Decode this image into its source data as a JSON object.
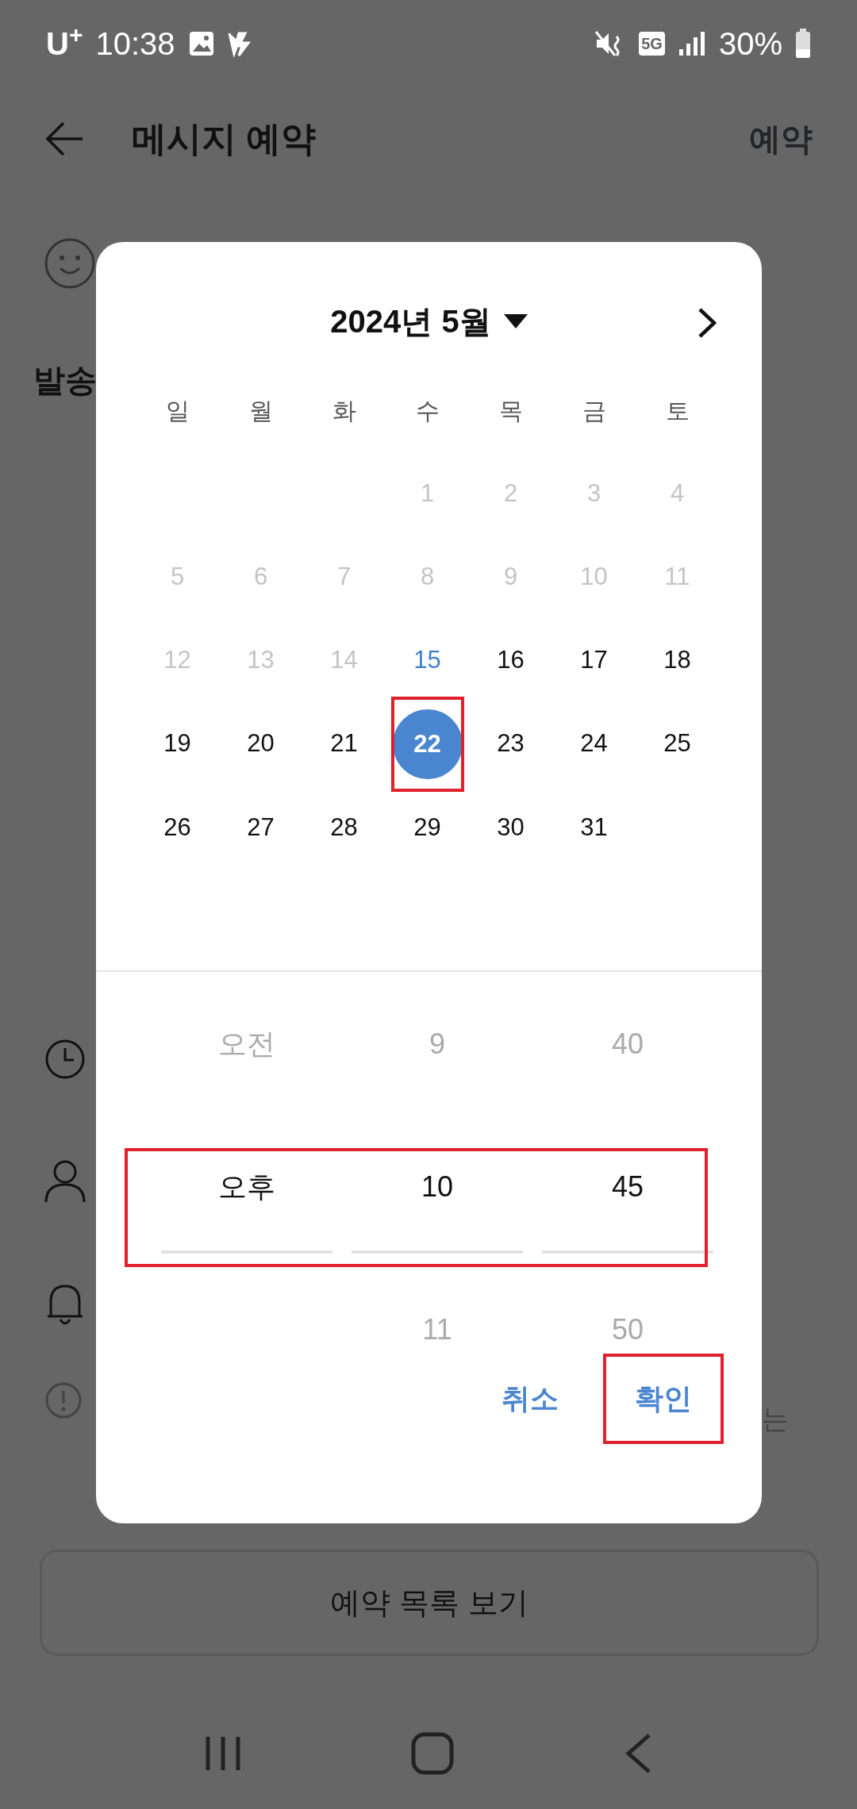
{
  "status_bar": {
    "carrier": "U$^{+}$",
    "time": "10:38",
    "network": "5G",
    "battery": "30%"
  },
  "app_bar": {
    "title": "메시지 예약",
    "action": "예약"
  },
  "background": {
    "section_label": "발송",
    "hint_fragment": "는",
    "list_button": "예약 목록 보기"
  },
  "dialog": {
    "month_title": "2024년 5월",
    "weekdays": [
      "일",
      "월",
      "화",
      "수",
      "목",
      "금",
      "토"
    ],
    "weeks": [
      [
        {
          "day": "1",
          "disabled": true,
          "today": false,
          "selected": false
        },
        {
          "day": "2",
          "disabled": true,
          "today": false,
          "selected": false
        },
        {
          "day": "3",
          "disabled": true,
          "today": false,
          "selected": false
        },
        {
          "day": "4",
          "disabled": true,
          "today": false,
          "selected": false
        }
      ],
      [
        {
          "day": "5",
          "disabled": true,
          "today": false,
          "selected": false
        },
        {
          "day": "6",
          "disabled": true,
          "today": false,
          "selected": false
        },
        {
          "day": "7",
          "disabled": true,
          "today": false,
          "selected": false
        },
        {
          "day": "8",
          "disabled": true,
          "today": false,
          "selected": false
        },
        {
          "day": "9",
          "disabled": true,
          "today": false,
          "selected": false
        },
        {
          "day": "10",
          "disabled": true,
          "today": false,
          "selected": false
        },
        {
          "day": "11",
          "disabled": true,
          "today": false,
          "selected": false
        }
      ],
      [
        {
          "day": "12",
          "disabled": true,
          "today": false,
          "selected": false
        },
        {
          "day": "13",
          "disabled": true,
          "today": false,
          "selected": false
        },
        {
          "day": "14",
          "disabled": true,
          "today": false,
          "selected": false
        },
        {
          "day": "15",
          "disabled": false,
          "today": true,
          "selected": false
        },
        {
          "day": "16",
          "disabled": false,
          "today": false,
          "selected": false
        },
        {
          "day": "17",
          "disabled": false,
          "today": false,
          "selected": false
        },
        {
          "day": "18",
          "disabled": false,
          "today": false,
          "selected": false
        }
      ],
      [
        {
          "day": "19",
          "disabled": false,
          "today": false,
          "selected": false
        },
        {
          "day": "20",
          "disabled": false,
          "today": false,
          "selected": false
        },
        {
          "day": "21",
          "disabled": false,
          "today": false,
          "selected": false
        },
        {
          "day": "22",
          "disabled": false,
          "today": false,
          "selected": true,
          "highlighted": true
        },
        {
          "day": "23",
          "disabled": false,
          "today": false,
          "selected": false
        },
        {
          "day": "24",
          "disabled": false,
          "today": false,
          "selected": false
        },
        {
          "day": "25",
          "disabled": false,
          "today": false,
          "selected": false
        }
      ],
      [
        {
          "day": "26",
          "disabled": false,
          "today": false,
          "selected": false
        },
        {
          "day": "27",
          "disabled": false,
          "today": false,
          "selected": false
        },
        {
          "day": "28",
          "disabled": false,
          "today": false,
          "selected": false
        },
        {
          "day": "29",
          "disabled": false,
          "today": false,
          "selected": false
        },
        {
          "day": "30",
          "disabled": false,
          "today": false,
          "selected": false
        },
        {
          "day": "31",
          "disabled": false,
          "today": false,
          "selected": false
        }
      ]
    ],
    "time_picker": {
      "highlighted": true,
      "columns": [
        {
          "items": [
            {
              "text": "오전",
              "selected": false
            },
            {
              "text": "오후",
              "selected": true
            }
          ]
        },
        {
          "items": [
            {
              "text": "9",
              "selected": false
            },
            {
              "text": "10",
              "selected": true
            },
            {
              "text": "11",
              "selected": false
            }
          ]
        },
        {
          "items": [
            {
              "text": "40",
              "selected": false
            },
            {
              "text": "45",
              "selected": true
            },
            {
              "text": "50",
              "selected": false
            }
          ]
        }
      ]
    },
    "buttons": [
      {
        "label": "취소",
        "highlighted": false
      },
      {
        "label": "확인",
        "highlighted": true
      }
    ]
  }
}
